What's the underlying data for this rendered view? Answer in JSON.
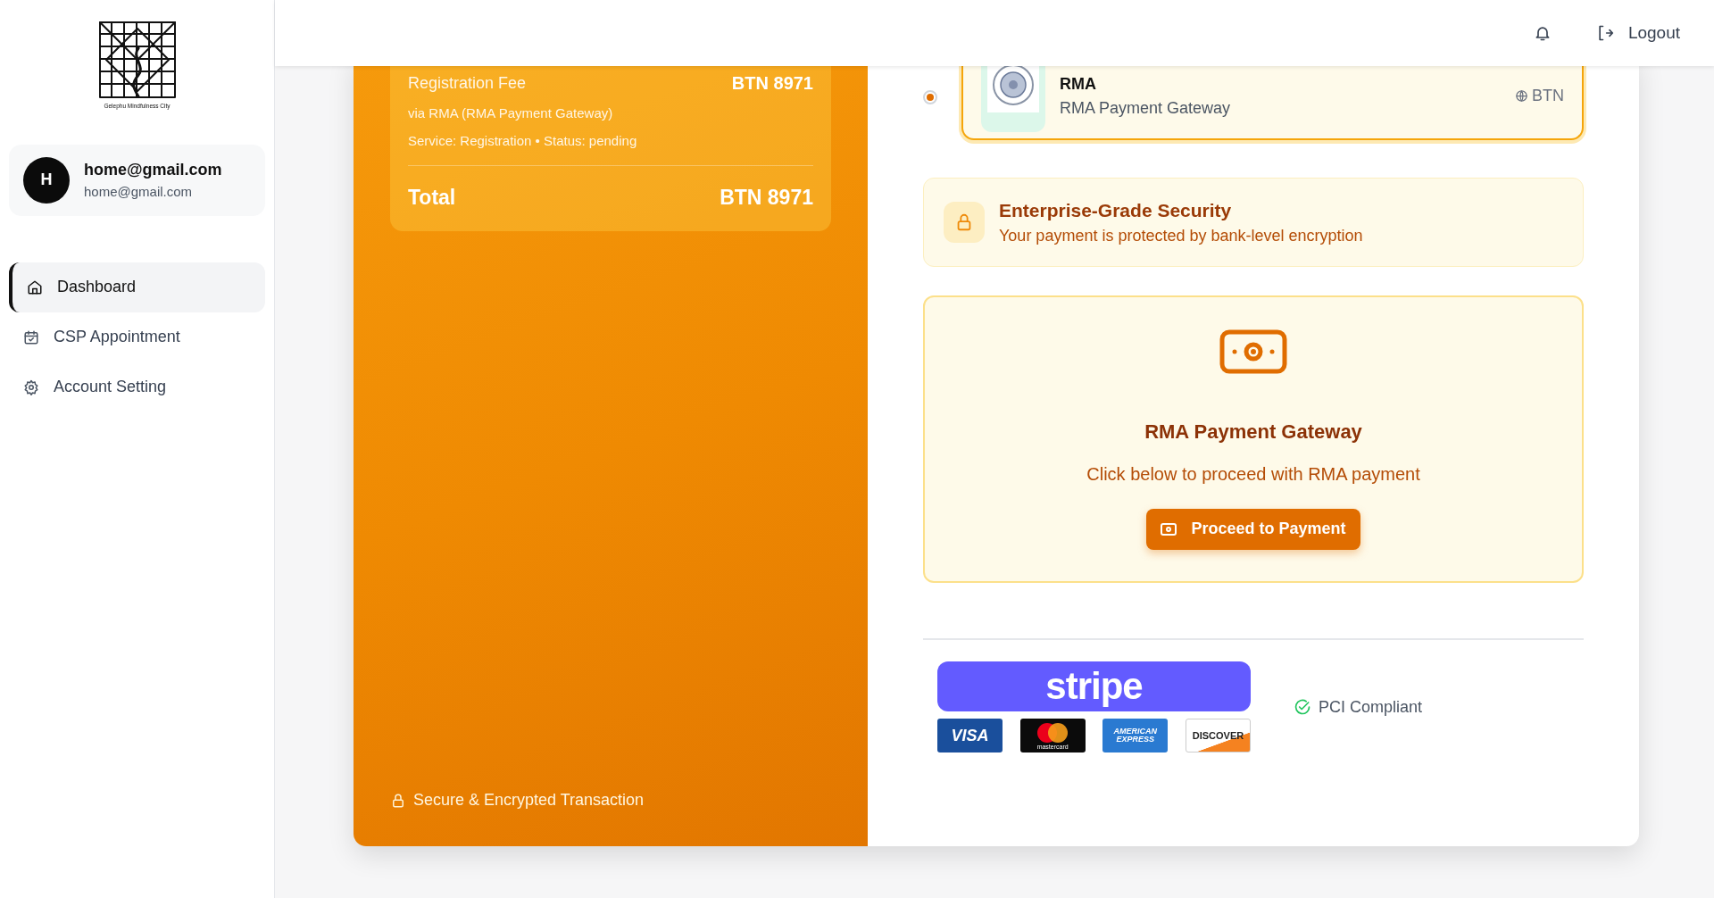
{
  "sidebar": {
    "logo_caption": "Gelephu Mindfulness City",
    "user": {
      "initial": "H",
      "name": "home@gmail.com",
      "email": "home@gmail.com"
    },
    "items": [
      {
        "label": "Dashboard",
        "kind": "home",
        "selected": true
      },
      {
        "label": "CSP Appointment",
        "kind": "calendar",
        "selected": false
      },
      {
        "label": "Account Setting",
        "kind": "gear",
        "selected": false
      }
    ]
  },
  "header": {
    "logout": "Logout"
  },
  "summary": {
    "items": [
      {
        "label": "Registration Fee",
        "amount": "BTN 8971",
        "via": "via RMA (RMA Payment Gateway)",
        "meta": "Service: Registration • Status: pending"
      }
    ],
    "total_label": "Total",
    "total": "BTN 8971",
    "secure_note": "Secure & Encrypted Transaction"
  },
  "methods": [
    {
      "name": "RMA",
      "description": "RMA Payment Gateway",
      "currency": "BTN",
      "selected": true
    }
  ],
  "security": {
    "title": "Enterprise-Grade Security",
    "subtitle": "Your payment is protected by bank-level encryption"
  },
  "gateway": {
    "title": "RMA Payment Gateway",
    "subtitle": "Click below to proceed with RMA payment",
    "button": "Proceed to Payment"
  },
  "footer": {
    "stripe": "stripe",
    "cards": [
      {
        "kind": "visa",
        "lines": [
          "VISA"
        ]
      },
      {
        "kind": "mastercard",
        "lines": [
          "mastercard"
        ]
      },
      {
        "kind": "amex",
        "lines": [
          "AMERICAN",
          "EXPRESS"
        ]
      },
      {
        "kind": "discover",
        "lines": [
          "DISCOVER"
        ]
      }
    ],
    "badge": "PCI Compliant"
  }
}
